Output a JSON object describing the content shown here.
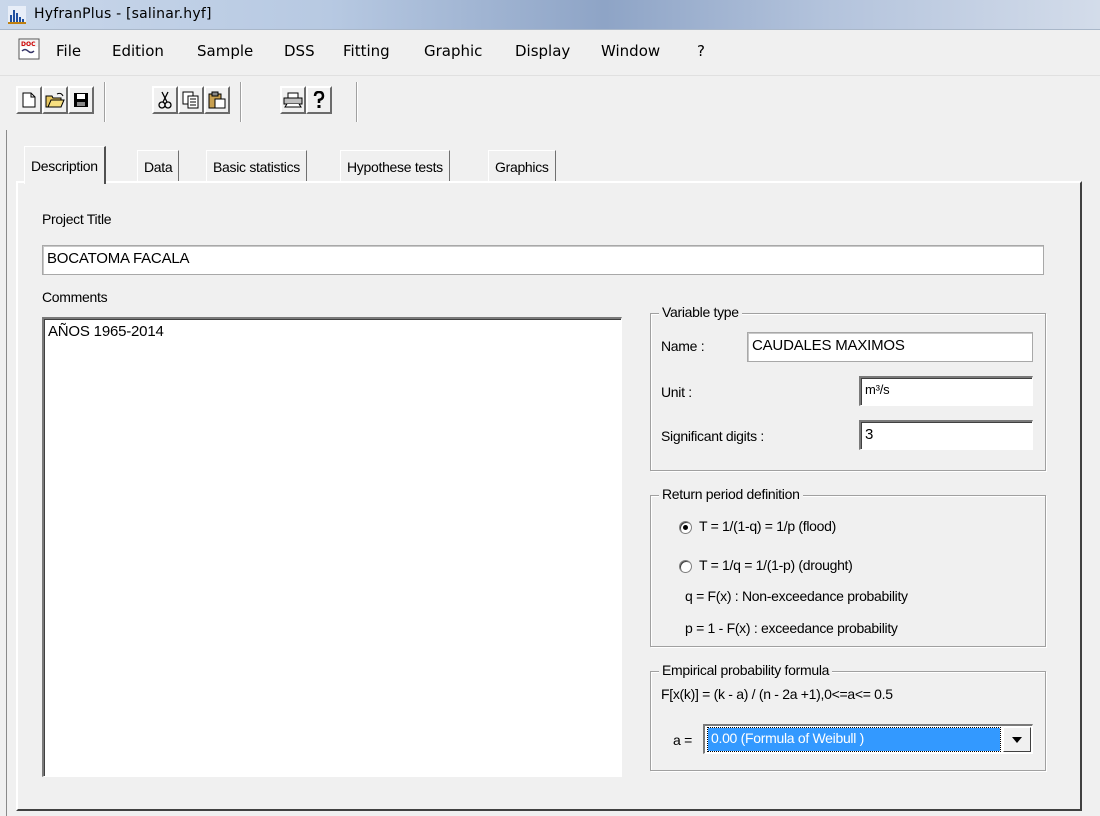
{
  "window": {
    "title": "HyfranPlus - [salinar.hyf]"
  },
  "menu": [
    "File",
    "Edition",
    "Sample",
    "DSS",
    "Fitting",
    "Graphic",
    "Display",
    "Window",
    "?"
  ],
  "toolbar": {
    "icons": [
      "new-file-icon",
      "open-folder-icon",
      "save-icon",
      "cut-icon",
      "copy-icon",
      "paste-icon",
      "print-icon",
      "help-icon"
    ]
  },
  "tabs": [
    "Description",
    "Data",
    "Basic statistics",
    "Hypothese tests",
    "Graphics"
  ],
  "description": {
    "project_title_label": "Project Title",
    "project_title_value": "BOCATOMA FACALA",
    "comments_label": "Comments",
    "comments_value": "AÑOS 1965-2014"
  },
  "variable_type": {
    "legend": "Variable type",
    "name_label": "Name :",
    "name_value": "CAUDALES MAXIMOS",
    "unit_label": "Unit :",
    "unit_value": "m³/s",
    "digits_label": "Significant digits :",
    "digits_value": "3"
  },
  "return_period": {
    "legend": "Return period definition",
    "option_flood": "T = 1/(1-q)  = 1/p (flood)",
    "option_drought": "T = 1/q = 1/(1-p) (drought)",
    "note_q": "q = F(x) : Non-exceedance probability",
    "note_p": "p = 1 - F(x) : exceedance probability",
    "selected": "flood"
  },
  "empirical": {
    "legend": "Empirical probability formula",
    "formula": "F[x(k)] = (k - a) / (n - 2a +1),0<=a<= 0.5",
    "a_label": "a =",
    "a_value": "0.00 (Formula of  Weibull )"
  },
  "colors": {
    "selection": "#3399ff",
    "face": "#f0f0f0"
  }
}
